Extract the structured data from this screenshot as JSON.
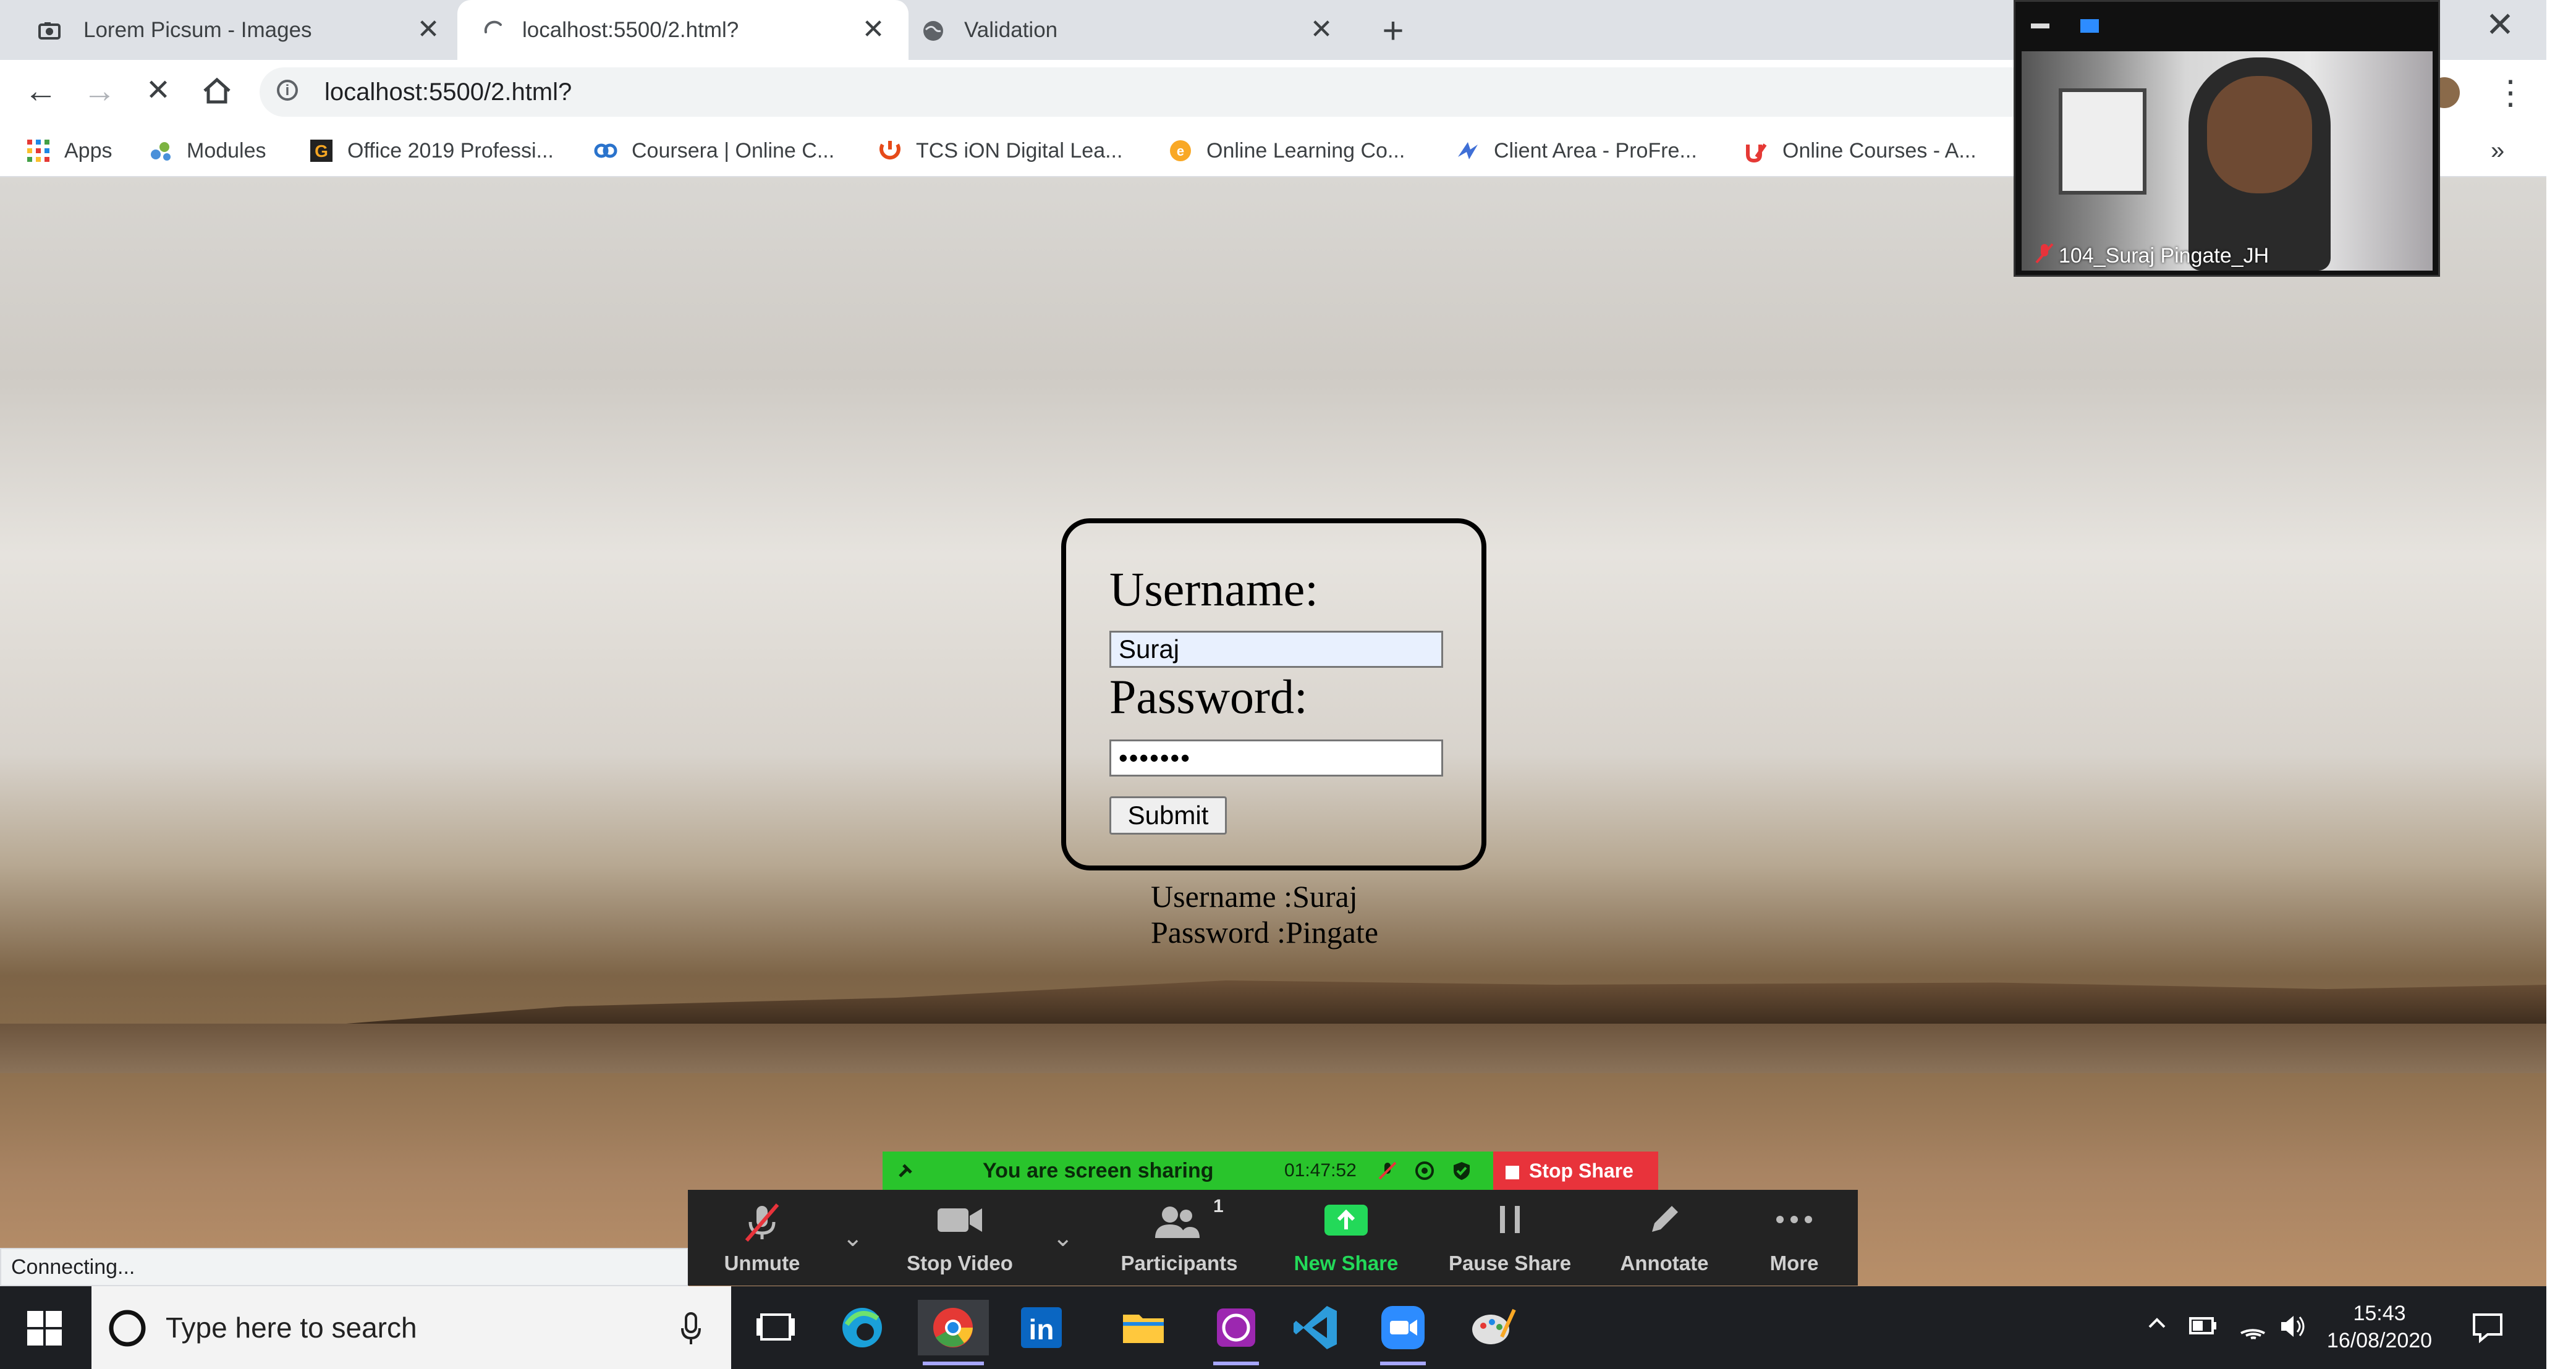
{
  "browser": {
    "tabs": [
      {
        "label": "Lorem Picsum - Images",
        "icon": "picsum-favicon-icon"
      },
      {
        "label": "localhost:5500/2.html?",
        "icon": "loading-spinner-icon",
        "active": true
      },
      {
        "label": "Validation",
        "icon": "globe-icon"
      }
    ],
    "url": "localhost:5500/2.html?",
    "bookmarks": [
      {
        "label": "Apps",
        "icon": "apps-grid-icon"
      },
      {
        "label": "Modules",
        "icon": "modules-icon"
      },
      {
        "label": "Office 2019 Professi...",
        "icon": "office-icon"
      },
      {
        "label": "Coursera | Online C...",
        "icon": "coursera-icon"
      },
      {
        "label": "TCS iON Digital Lea...",
        "icon": "tcs-icon"
      },
      {
        "label": "Online Learning Co...",
        "icon": "online-learning-icon"
      },
      {
        "label": "Client Area - ProFre...",
        "icon": "client-area-icon"
      },
      {
        "label": "Online Courses - A...",
        "icon": "udemy-icon"
      }
    ],
    "status": "Connecting..."
  },
  "login": {
    "username_label": "Username:",
    "username_value": "Suraj",
    "password_label": "Password:",
    "password_value": "•••••••",
    "submit_label": "Submit"
  },
  "output": {
    "line1": "Username :Suraj",
    "line2": "Password :Pingate"
  },
  "zoom": {
    "sharing_text": "You are screen sharing",
    "timer": "01:47:52",
    "stop_share": "Stop Share",
    "participant_name": "104_Suraj Pingate_JH",
    "participant_count": "1",
    "controls": [
      {
        "label": "Unmute",
        "icon": "mic-muted-icon"
      },
      {
        "label": "Stop Video",
        "icon": "video-camera-icon"
      },
      {
        "label": "Participants",
        "icon": "participants-icon"
      },
      {
        "label": "New Share",
        "icon": "new-share-icon"
      },
      {
        "label": "Pause Share",
        "icon": "pause-icon"
      },
      {
        "label": "Annotate",
        "icon": "pencil-icon"
      },
      {
        "label": "More",
        "icon": "more-dots-icon"
      }
    ],
    "colors": {
      "sharing_green": "#29c42c",
      "stop_red": "#e8333b",
      "new_share_green": "#23d959"
    }
  },
  "taskbar": {
    "search_placeholder": "Type here to search",
    "time": "15:43",
    "date": "16/08/2020"
  }
}
